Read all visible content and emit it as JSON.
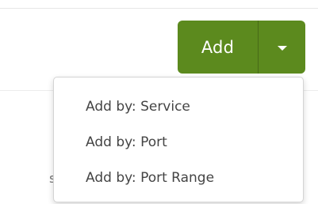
{
  "colors": {
    "accent": "#5c8a1e"
  },
  "split_button": {
    "add_label": "Add",
    "toggle_icon": "chevron-down-icon"
  },
  "dropdown": {
    "items": [
      {
        "label": "Add by: Service"
      },
      {
        "label": "Add by: Port"
      },
      {
        "label": "Add by: Port Range"
      }
    ]
  },
  "background": {
    "peek_text": "s"
  }
}
